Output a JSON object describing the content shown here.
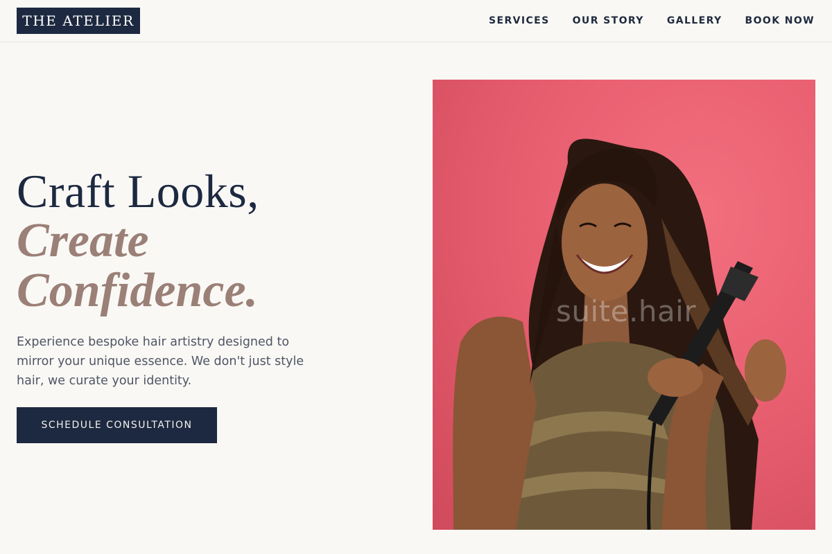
{
  "brand": {
    "logo_text": "THE ATELIER"
  },
  "nav": {
    "items": [
      {
        "label": "SERVICES"
      },
      {
        "label": "OUR STORY"
      },
      {
        "label": "GALLERY"
      },
      {
        "label": "BOOK NOW"
      }
    ]
  },
  "hero": {
    "headline_line1": "Craft Looks,",
    "headline_line2": "Create",
    "headline_line3": "Confidence.",
    "lede": "Experience bespoke hair artistry designed to mirror your unique essence. We don't just style hair, we curate your identity.",
    "cta_label": "SCHEDULE CONSULTATION",
    "image_watermark": "suite.hair",
    "image_alt": "Smiling woman with long straight hair using a hair straightener against a pink background"
  },
  "colors": {
    "navy": "#1d2940",
    "mauve": "#9b8077",
    "background": "#f9f8f5",
    "image_backdrop": "#e85f70"
  }
}
